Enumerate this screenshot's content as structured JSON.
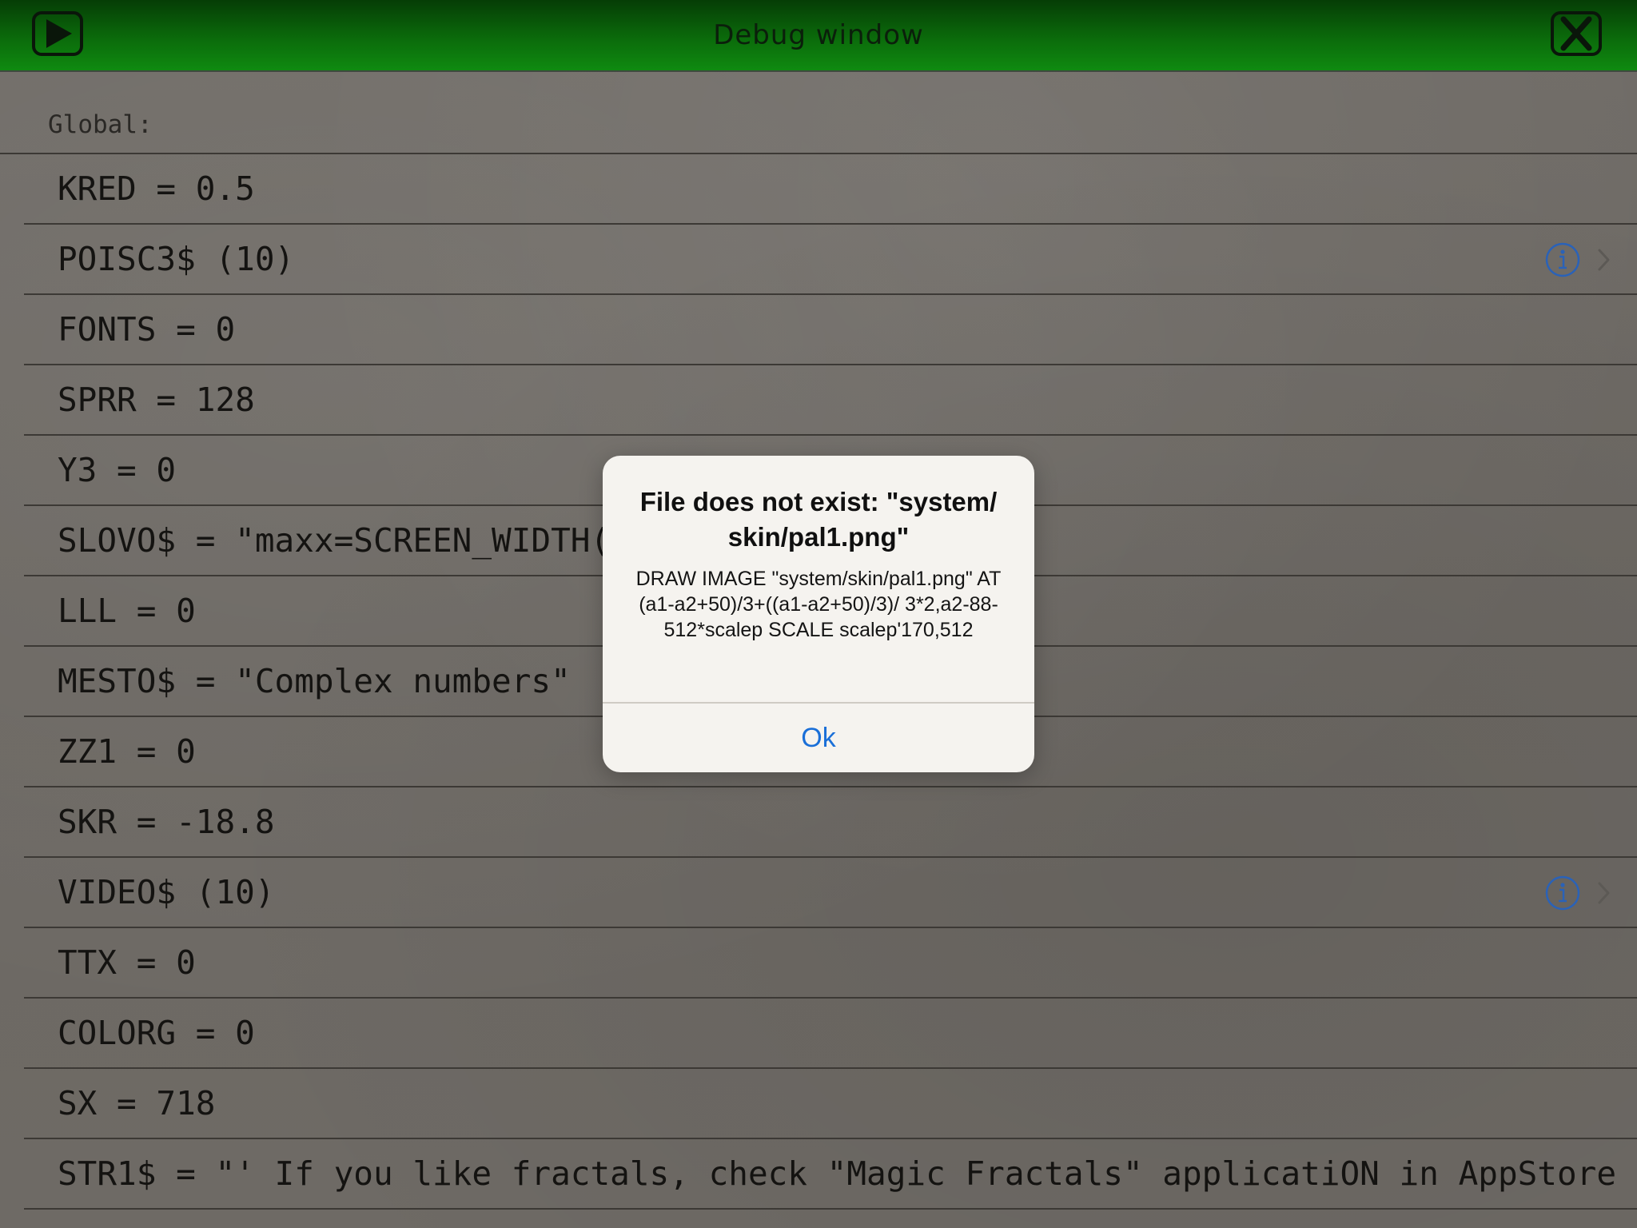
{
  "header": {
    "title": "Debug window",
    "play_icon": "play-icon",
    "close_icon": "close-x-icon",
    "color": "#0b6b0b"
  },
  "section": {
    "label": "Global:"
  },
  "variables": [
    {
      "text": "KRED = 0.5",
      "has_detail": false
    },
    {
      "text": "POISC3$ (10)",
      "has_detail": true
    },
    {
      "text": "FONTS = 0",
      "has_detail": false
    },
    {
      "text": "SPRR = 128",
      "has_detail": false
    },
    {
      "text": "Y3 = 0",
      "has_detail": false
    },
    {
      "text": "SLOVO$ = \"maxx=SCREEN_WIDTH()",
      "has_detail": false
    },
    {
      "text": "LLL = 0",
      "has_detail": false
    },
    {
      "text": "MESTO$ = \"Complex numbers\"",
      "has_detail": false
    },
    {
      "text": "ZZ1 = 0",
      "has_detail": false
    },
    {
      "text": "SKR = -18.8",
      "has_detail": false
    },
    {
      "text": "VIDEO$ (10)",
      "has_detail": true
    },
    {
      "text": "TTX = 0",
      "has_detail": false
    },
    {
      "text": "COLORG = 0",
      "has_detail": false
    },
    {
      "text": "SX = 718",
      "has_detail": false
    },
    {
      "text": "STR1$ = \"' If you like fractals, check \"Magic Fractals\" applicatiON in AppStore",
      "has_detail": false
    }
  ],
  "alert": {
    "title": "File does not exist: \"system/ skin/pal1.png\"",
    "message": "DRAW IMAGE \"system/skin/pal1.png\" AT (a1-a2+50)/3+((a1-a2+50)/3)/ 3*2,a2-88-512*scalep SCALE scalep'170,512",
    "button_label": "Ok",
    "button_color": "#1a6fd8"
  },
  "icons": {
    "info": "info-circle-icon",
    "chevron": "chevron-right-icon"
  }
}
